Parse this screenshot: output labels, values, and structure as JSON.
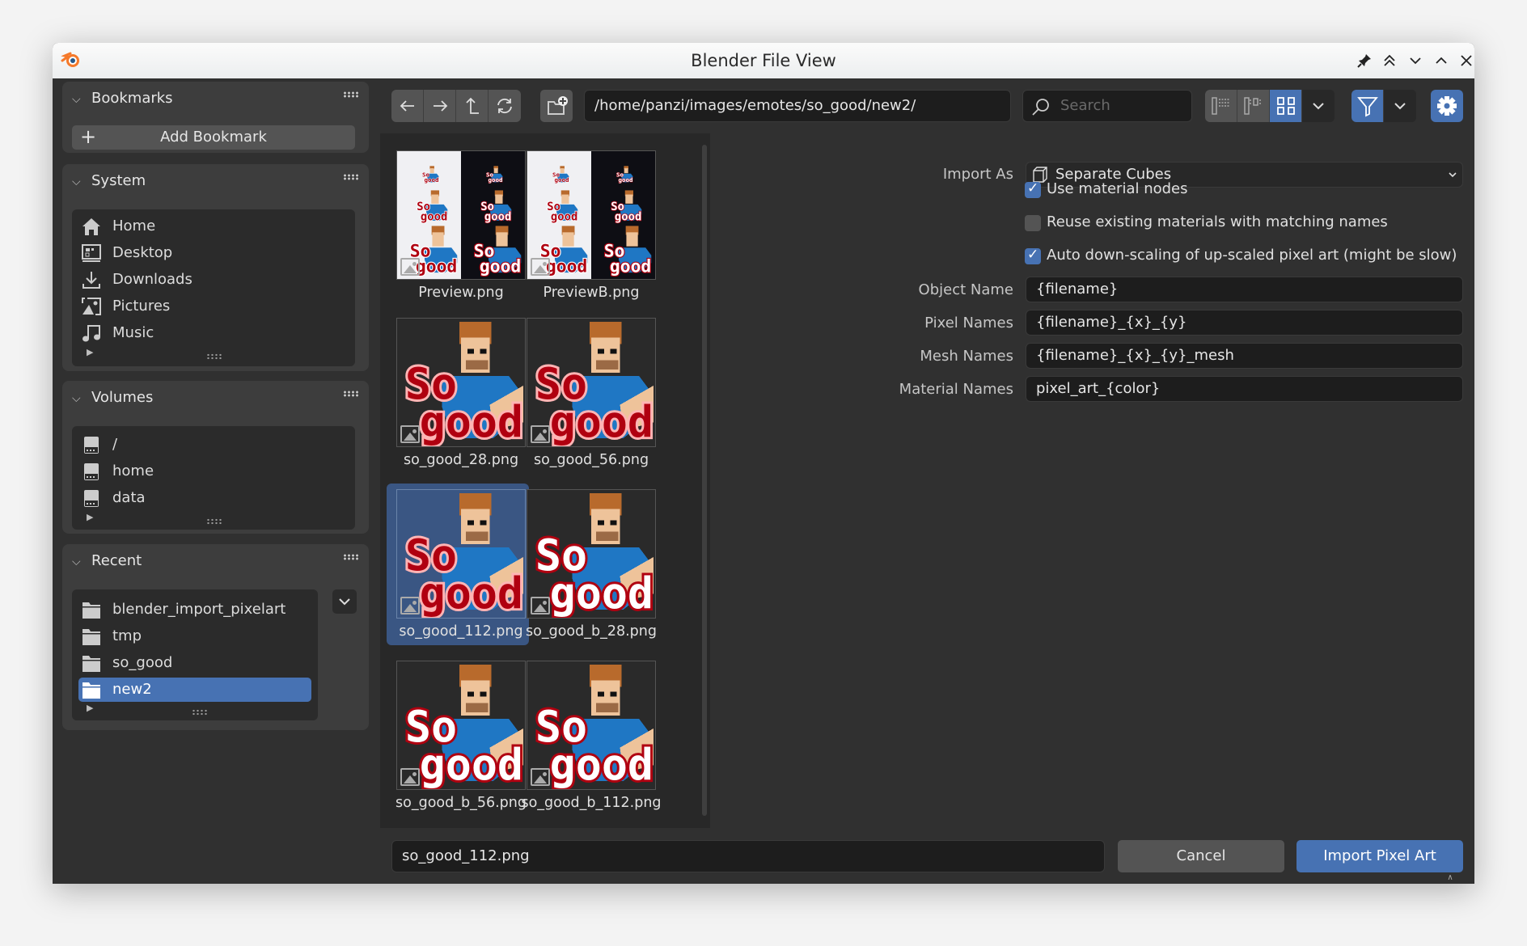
{
  "window": {
    "title": "Blender File View",
    "controls": [
      "pin-icon",
      "keep-above-icon",
      "minimize-icon",
      "maximize-icon",
      "close-icon"
    ]
  },
  "sidebar": {
    "bookmarks": {
      "title": "Bookmarks",
      "add_label": "Add Bookmark"
    },
    "system": {
      "title": "System",
      "items": [
        {
          "label": "Home",
          "icon": "home-icon"
        },
        {
          "label": "Desktop",
          "icon": "desktop-icon"
        },
        {
          "label": "Downloads",
          "icon": "download-icon"
        },
        {
          "label": "Pictures",
          "icon": "image-icon"
        },
        {
          "label": "Music",
          "icon": "music-icon"
        }
      ]
    },
    "volumes": {
      "title": "Volumes",
      "items": [
        {
          "label": "/",
          "icon": "disk-icon"
        },
        {
          "label": "home",
          "icon": "disk-icon"
        },
        {
          "label": "data",
          "icon": "disk-icon"
        }
      ]
    },
    "recent": {
      "title": "Recent",
      "items": [
        {
          "label": "blender_import_pixelart",
          "icon": "folder-icon",
          "active": false
        },
        {
          "label": "tmp",
          "icon": "folder-icon",
          "active": false
        },
        {
          "label": "so_good",
          "icon": "folder-icon",
          "active": false
        },
        {
          "label": "new2",
          "icon": "folder-icon",
          "active": true
        }
      ]
    }
  },
  "toolbar": {
    "nav": [
      "back-icon",
      "forward-icon",
      "parent-directory-icon",
      "refresh-icon"
    ],
    "path": "/home/panzi/images/emotes/so_good/new2/",
    "search_placeholder": "Search",
    "display_mode": "thumbnails",
    "filter_enabled": true
  },
  "files": [
    {
      "name": "Preview.png",
      "kind": "preview",
      "selected": false
    },
    {
      "name": "PreviewB.png",
      "kind": "previewB",
      "selected": false
    },
    {
      "name": "so_good_28.png",
      "kind": "pink",
      "selected": false
    },
    {
      "name": "so_good_56.png",
      "kind": "pink",
      "selected": false
    },
    {
      "name": "so_good_112.png",
      "kind": "pink",
      "selected": true
    },
    {
      "name": "so_good_b_28.png",
      "kind": "white",
      "selected": false
    },
    {
      "name": "so_good_b_56.png",
      "kind": "white",
      "selected": false
    },
    {
      "name": "so_good_b_112.png",
      "kind": "white",
      "selected": false
    }
  ],
  "options": {
    "import_as": {
      "label": "Import As",
      "value": "Separate Cubes"
    },
    "checkboxes": [
      {
        "label": "Use material nodes",
        "checked": true
      },
      {
        "label": "Reuse existing materials with matching names",
        "checked": false
      },
      {
        "label": "Auto down-scaling of up-scaled pixel art (might be slow)",
        "checked": true
      }
    ],
    "fields": [
      {
        "label": "Object Name",
        "value": "{filename}"
      },
      {
        "label": "Pixel Names",
        "value": "{filename}_{x}_{y}"
      },
      {
        "label": "Mesh Names",
        "value": "{filename}_{x}_{y}_mesh"
      },
      {
        "label": "Material Names",
        "value": "pixel_art_{color}"
      }
    ]
  },
  "footer": {
    "filename": "so_good_112.png",
    "cancel_label": "Cancel",
    "confirm_label": "Import Pixel Art"
  },
  "colors": {
    "accent": "#4772b3",
    "selection": "#3a5683",
    "shirt": "#1f77c4",
    "text_red": "#b00010",
    "text_pink": "#ffb4b4",
    "skin": "#eec39a",
    "hair": "#b86a2c"
  }
}
